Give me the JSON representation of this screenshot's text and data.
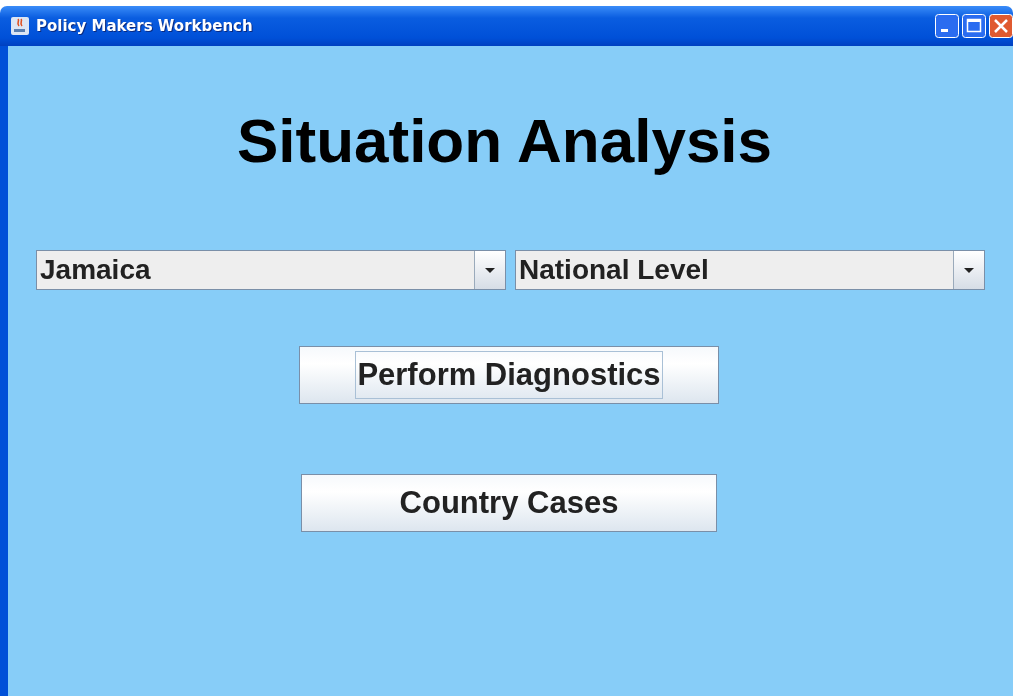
{
  "window": {
    "title": "Policy Makers Workbench"
  },
  "heading": "Situation Analysis",
  "dropdowns": [
    {
      "value": "Jamaica"
    },
    {
      "value": "National Level"
    }
  ],
  "buttons": [
    {
      "label": "Perform Diagnostics",
      "focused": true
    },
    {
      "label": "Country Cases",
      "focused": false
    }
  ]
}
